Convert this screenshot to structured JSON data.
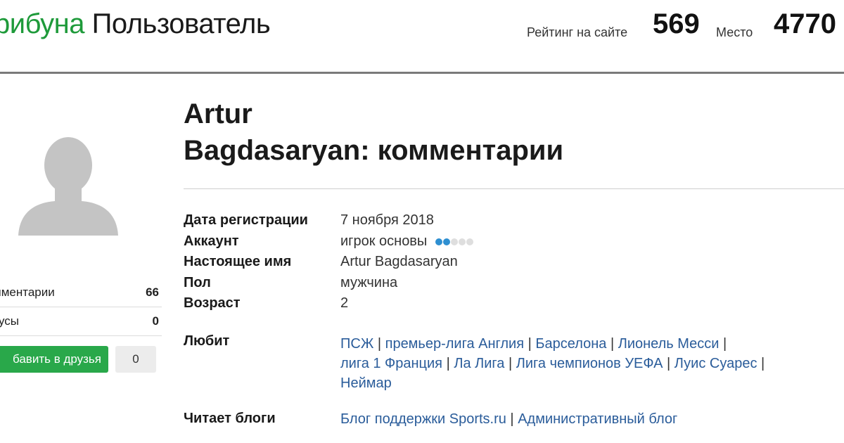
{
  "header": {
    "brand_green": "рибуна",
    "brand_dark": "Пользователь",
    "rating_label": "Рейтинг на сайте",
    "rating_value": "569",
    "place_label": "Место",
    "place_value": "4770"
  },
  "sidebar": {
    "avatar_icon": "user-silhouette-icon",
    "stats": [
      {
        "label": "мментарии",
        "value": "66"
      },
      {
        "label": "тусы",
        "value": "0"
      }
    ],
    "add_friend_label": "бавить в друзья",
    "friend_count": "0"
  },
  "profile": {
    "title_line1": "Artur",
    "title_line2": "Bagdasaryan: комментарии",
    "registration_label": "Дата регистрации",
    "registration_value": "7 ноября 2018",
    "account_label": "Аккаунт",
    "account_value": "игрок основы",
    "account_level": {
      "filled": 2,
      "total": 5
    },
    "realname_label": "Настоящее имя",
    "realname_value": "Artur Bagdasaryan",
    "gender_label": "Пол",
    "gender_value": "мужчина",
    "age_label": "Возраст",
    "age_value": "2",
    "likes_label": "Любит",
    "likes": [
      "ПСЖ",
      "премьер-лига Англия",
      "Барселона",
      "Лионель Месси",
      "лига 1 Франция",
      "Ла Лига",
      "Лига чемпионов УЕФА",
      "Луис Суарес",
      "Неймар"
    ],
    "blogs_label": "Читает блоги",
    "blogs": [
      "Блог поддержки Sports.ru",
      "Административный блог"
    ]
  },
  "colors": {
    "brand_green": "#1e9a3a",
    "button_green": "#29a84a",
    "link_blue": "#2a5c9a",
    "dot_active": "#2e8fd1"
  }
}
